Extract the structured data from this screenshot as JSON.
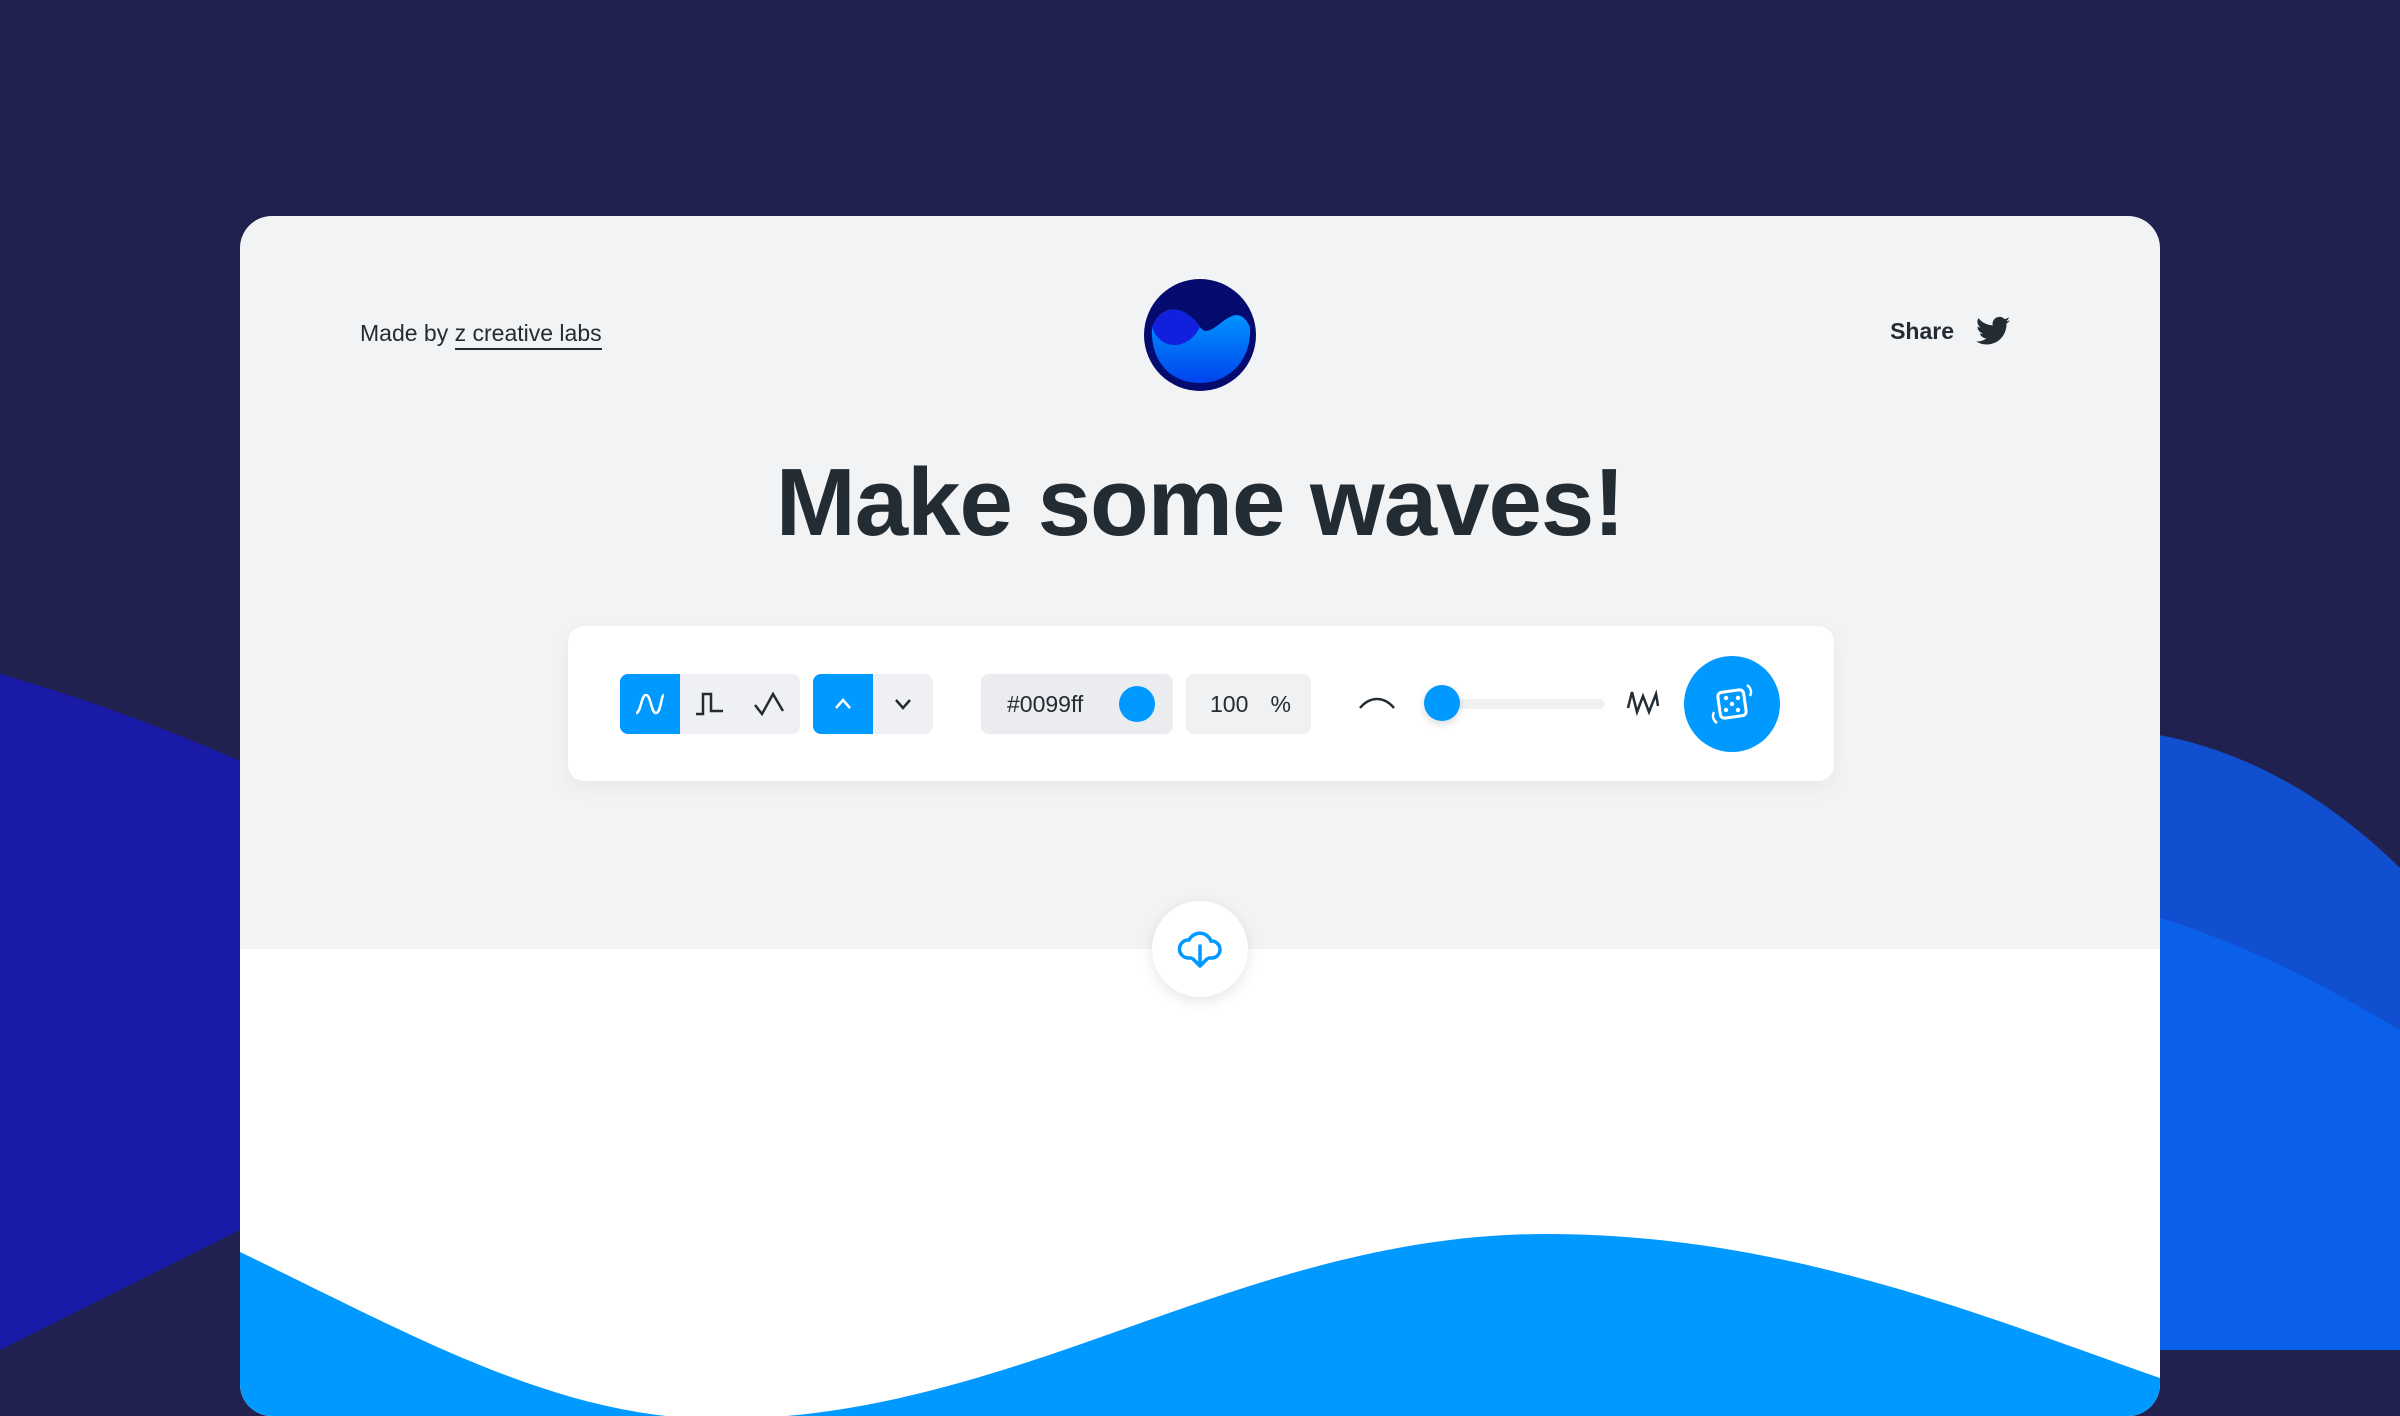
{
  "header": {
    "made_by": "Made by",
    "made_by_link": "z creative labs",
    "share_label": "Share"
  },
  "title": "Make some waves!",
  "toolbar": {
    "wave_types": [
      "sine",
      "square",
      "sawtooth"
    ],
    "selected_wave": "sine",
    "directions": [
      "up",
      "down"
    ],
    "selected_direction": "up",
    "color_value": "#0099ff",
    "opacity_value": "100",
    "opacity_unit": "%",
    "complexity_fraction": 0.1
  },
  "colors": {
    "accent": "#0099ff",
    "background": "#21214f",
    "card": "#f2f3f5",
    "text": "#232b33"
  }
}
